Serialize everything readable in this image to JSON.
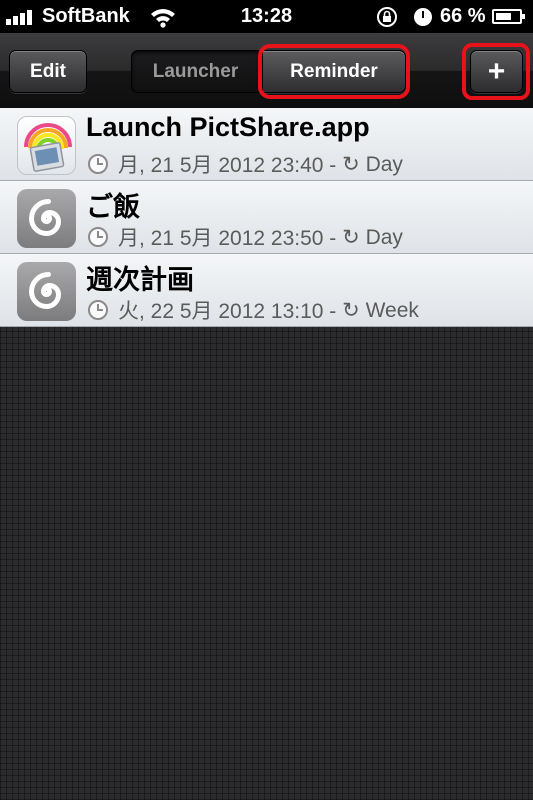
{
  "status_bar": {
    "carrier": "SoftBank",
    "time": "13:28",
    "battery_percent": "66 %",
    "battery_level": 0.66,
    "icons": [
      "signal-bars-icon",
      "wifi-icon",
      "rotation-lock-icon",
      "alarm-icon",
      "battery-icon"
    ]
  },
  "nav": {
    "edit_label": "Edit",
    "segments": [
      {
        "label": "Launcher",
        "selected": false
      },
      {
        "label": "Reminder",
        "selected": true
      }
    ],
    "add_label": "+",
    "highlight_color": "#e8121a"
  },
  "reminders": [
    {
      "icon": "pictshare-app-icon",
      "title": "Launch PictShare.app",
      "datetime": "月, 21 5月 2012 23:40 -",
      "repeat": "↻ Day"
    },
    {
      "icon": "spiral-app-icon",
      "title": "ご飯",
      "datetime": "月, 21 5月 2012 23:50 -",
      "repeat": "↻ Day"
    },
    {
      "icon": "spiral-app-icon",
      "title": "週次計画",
      "datetime": "火, 22 5月 2012 13:10 -",
      "repeat": "↻ Week"
    }
  ]
}
